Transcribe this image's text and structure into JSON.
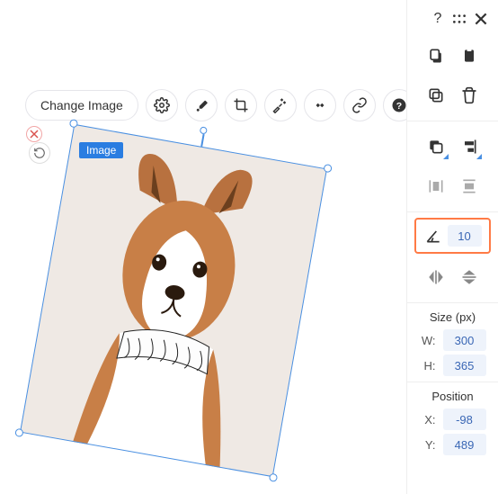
{
  "toolbar": {
    "change_image_label": "Change Image"
  },
  "selection": {
    "label": "Image"
  },
  "panel": {
    "rotation_value": "10",
    "size_title": "Size (px)",
    "width_label": "W:",
    "width_value": "300",
    "height_label": "H:",
    "height_value": "365",
    "position_title": "Position",
    "x_label": "X:",
    "x_value": "-98",
    "y_label": "Y:",
    "y_value": "489"
  },
  "colors": {
    "accent": "#4a90e2",
    "highlight": "#ff7a45"
  }
}
